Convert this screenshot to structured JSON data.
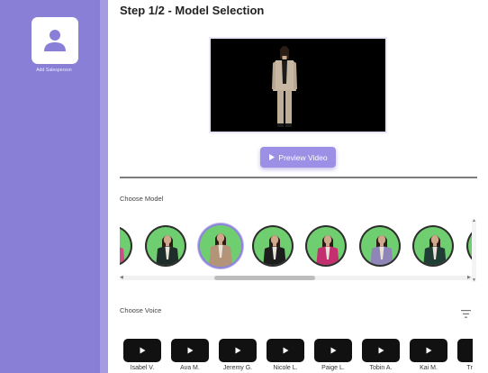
{
  "sidebar": {
    "add_label": "Add Salesperson",
    "accent": "#8a7fd6"
  },
  "main": {
    "title": "Step 1/2 - Model Selection",
    "preview_button": {
      "icon": "play-icon",
      "label": "Preview Video"
    },
    "choose_model_label": "Choose Model",
    "choose_voice_label": "Choose Voice"
  },
  "models": [
    {
      "outfit": "#c94f84",
      "selected": false,
      "partial": true
    },
    {
      "outfit": "#1f2d2a",
      "selected": false
    },
    {
      "outfit": "#b39478",
      "selected": true
    },
    {
      "outfit": "#1d1d1d",
      "selected": false
    },
    {
      "outfit": "#c42f6f",
      "selected": false
    },
    {
      "outfit": "#8f85b8",
      "selected": false
    },
    {
      "outfit": "#1f3d35",
      "selected": false
    },
    {
      "outfit": "#2a2a2a",
      "selected": false,
      "partial": true
    }
  ],
  "voices": [
    {
      "name": "Isabel V."
    },
    {
      "name": "Ava M."
    },
    {
      "name": "Jeremy G."
    },
    {
      "name": "Nicole L."
    },
    {
      "name": "Paige L."
    },
    {
      "name": "Tobin A."
    },
    {
      "name": "Kai M."
    },
    {
      "name": "Tristan"
    }
  ],
  "colors": {
    "button": "#9b8fe6",
    "selected_ring": "#8f84da",
    "model_background": "#6fce6f"
  }
}
